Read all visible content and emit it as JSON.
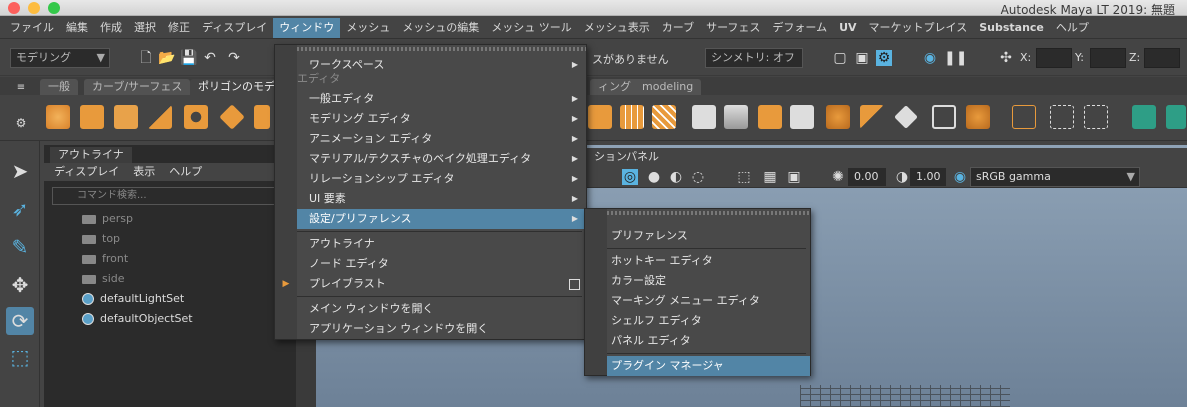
{
  "window": {
    "title": "Autodesk Maya LT 2019: 無題"
  },
  "menubar": [
    "ファイル",
    "編集",
    "作成",
    "選択",
    "修正",
    "ディスプレイ",
    "ウィンドウ",
    "メッシュ",
    "メッシュの編集",
    "メッシュ ツール",
    "メッシュ表示",
    "カーブ",
    "サーフェス",
    "デフォーム",
    "UV",
    "マーケットプレイス",
    "Substance",
    "ヘルプ"
  ],
  "statusline": {
    "mode": "モデリング",
    "live": "スがありません",
    "symmetry": "シンメトリ: オフ",
    "x_label": "X:",
    "y_label": "Y:",
    "z_label": "Z:"
  },
  "shelf_tabs": [
    "一般",
    "カーブ/サーフェス",
    "ポリゴンのモデ",
    "ィング",
    "modeling"
  ],
  "outliner": {
    "tab": "アウトライナ",
    "menu": [
      "ディスプレイ",
      "表示",
      "ヘルプ"
    ],
    "search_placeholder": "コマンド検索...",
    "items": [
      {
        "label": "persp",
        "kind": "camera"
      },
      {
        "label": "top",
        "kind": "camera"
      },
      {
        "label": "front",
        "kind": "camera"
      },
      {
        "label": "side",
        "kind": "camera"
      },
      {
        "label": "defaultLightSet",
        "kind": "set"
      },
      {
        "label": "defaultObjectSet",
        "kind": "set"
      }
    ]
  },
  "viewport": {
    "menu": [
      "ション",
      "パネル"
    ],
    "exposure": "0.00",
    "gamma": "1.00",
    "colorspace": "sRGB gamma"
  },
  "window_menu": {
    "items": [
      {
        "label": "ワークスペース",
        "submenu": true
      },
      {
        "label": "エディタ",
        "section": true
      },
      {
        "label": "一般エディタ",
        "submenu": true
      },
      {
        "label": "モデリング エディタ",
        "submenu": true
      },
      {
        "label": "アニメーション エディタ",
        "submenu": true
      },
      {
        "label": "マテリアル/テクスチャのベイク処理エディタ",
        "submenu": true
      },
      {
        "label": "リレーションシップ エディタ",
        "submenu": true
      },
      {
        "label": "UI 要素",
        "submenu": true
      },
      {
        "label": "設定/プリファレンス",
        "submenu": true,
        "highlighted": true
      },
      {
        "label": "アウトライナ"
      },
      {
        "label": "ノード エディタ"
      },
      {
        "label": "プレイブラスト",
        "option_box": true
      },
      {
        "label": "メイン ウィンドウを開く"
      },
      {
        "label": "アプリケーション ウィンドウを開く"
      }
    ]
  },
  "settings_submenu": {
    "items": [
      {
        "label": "プリファレンス"
      },
      {
        "label": "ホットキー エディタ"
      },
      {
        "label": "カラー設定"
      },
      {
        "label": "マーキング メニュー エディタ"
      },
      {
        "label": "シェルフ エディタ"
      },
      {
        "label": "パネル エディタ"
      },
      {
        "label": "プラグイン マネージャ",
        "highlighted": true
      }
    ]
  },
  "colors": {
    "highlight": "#5285a6",
    "menu_bg": "#494949",
    "accent_blue": "#5ab3e0"
  }
}
